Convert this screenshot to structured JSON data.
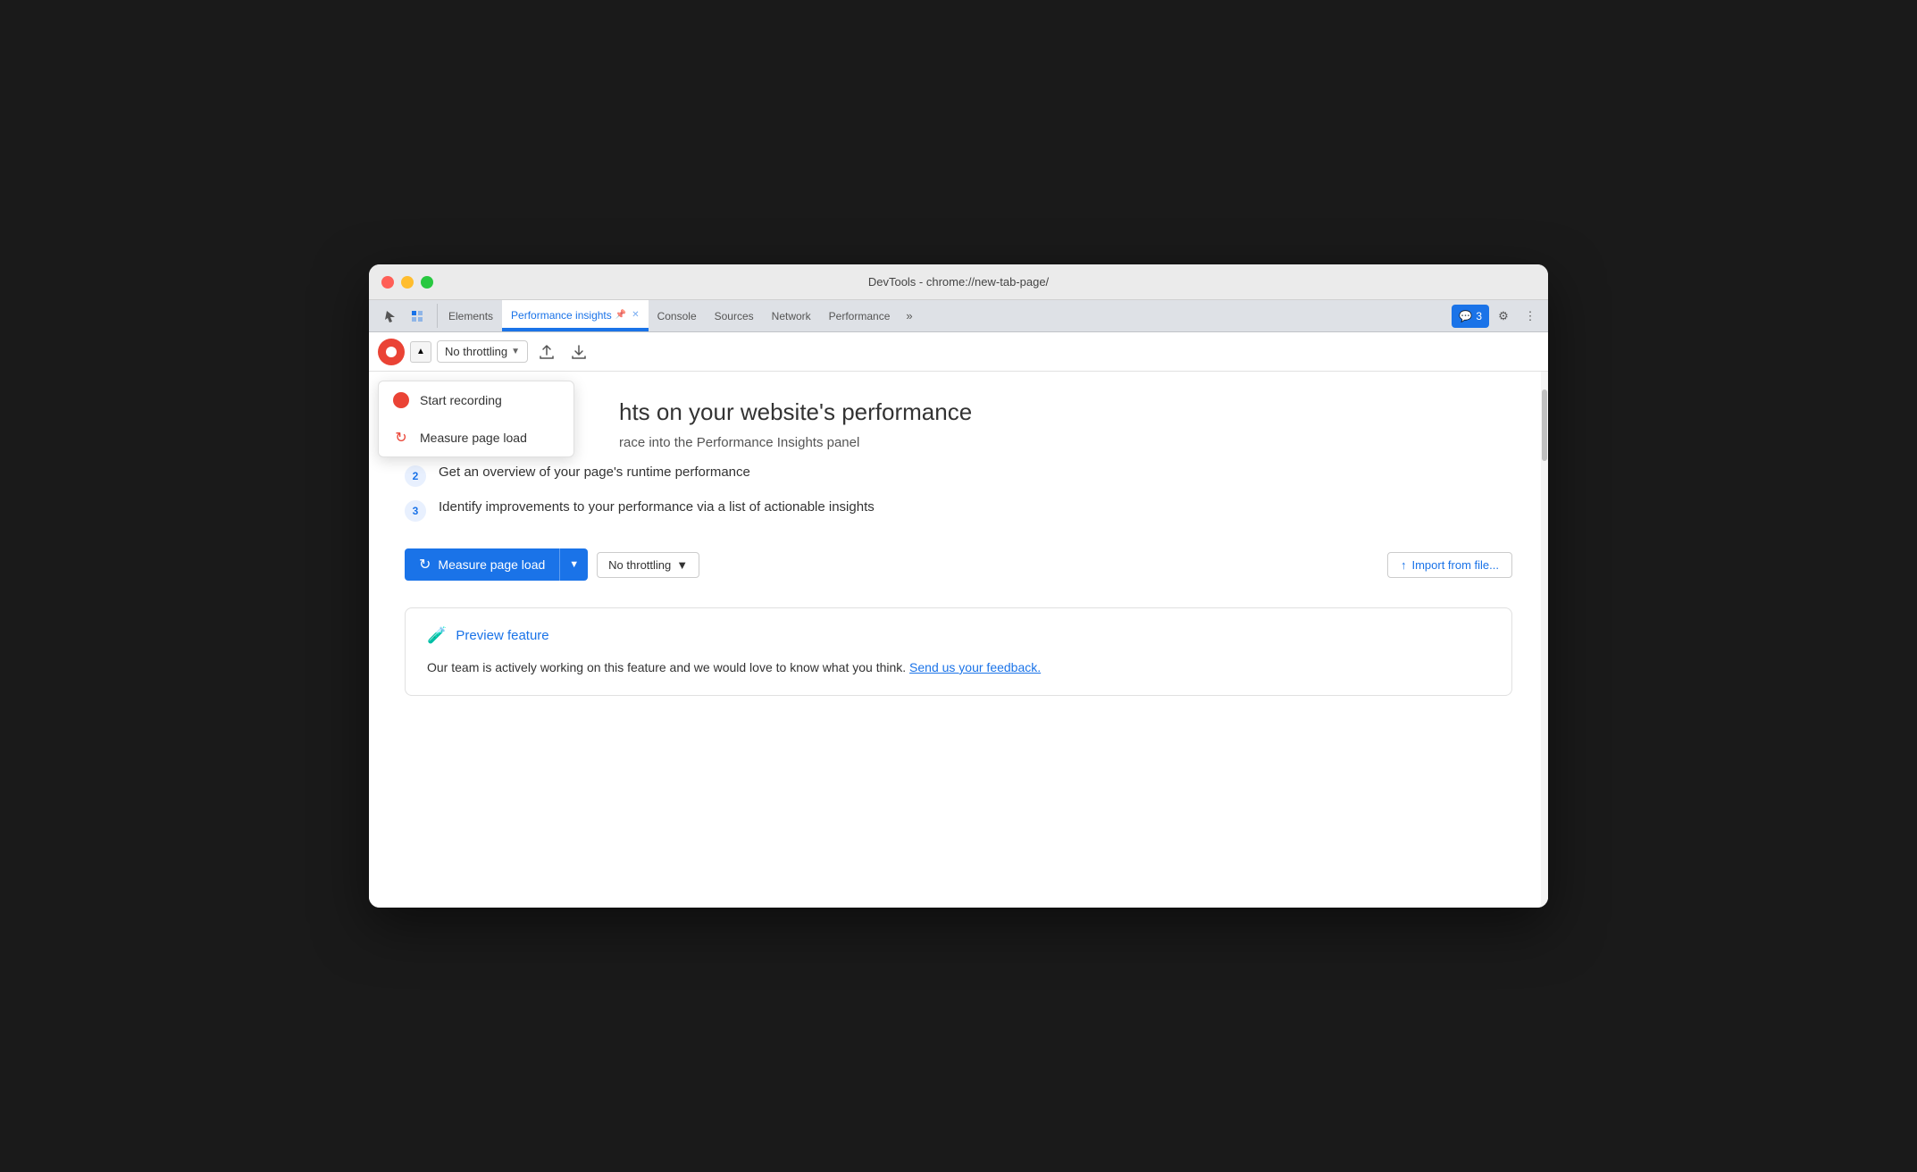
{
  "window": {
    "title": "DevTools - chrome://new-tab-page/"
  },
  "tabs": {
    "items": [
      {
        "label": "Elements",
        "active": false
      },
      {
        "label": "Performance insights",
        "active": true
      },
      {
        "label": "Console",
        "active": false
      },
      {
        "label": "Sources",
        "active": false
      },
      {
        "label": "Network",
        "active": false
      },
      {
        "label": "Performance",
        "active": false
      }
    ],
    "more_label": "»",
    "feedback_label": "3",
    "settings_label": "⚙",
    "more_options_label": "⋮"
  },
  "toolbar": {
    "throttling_label": "No throttling",
    "throttling_arrow": "▼"
  },
  "dropdown": {
    "start_recording_label": "Start recording",
    "measure_page_load_label": "Measure page load"
  },
  "main": {
    "heading": "hts on your website's performance",
    "subheading": "race into the Performance Insights panel",
    "steps": [
      {
        "number": "2",
        "text": "Get an overview of your page's runtime performance"
      },
      {
        "number": "3",
        "text": "Identify improvements to your performance via a list of actionable insights"
      }
    ],
    "measure_btn_label": "Measure page load",
    "measure_refresh_icon": "↻",
    "throttling_main_label": "No throttling",
    "import_label": "Import from file...",
    "import_icon": "↑"
  },
  "preview": {
    "title": "Preview feature",
    "flask_icon": "🧪",
    "description": "Our team is actively working on this feature and we would love to know what you think.",
    "link_text": "Send us your feedback."
  }
}
